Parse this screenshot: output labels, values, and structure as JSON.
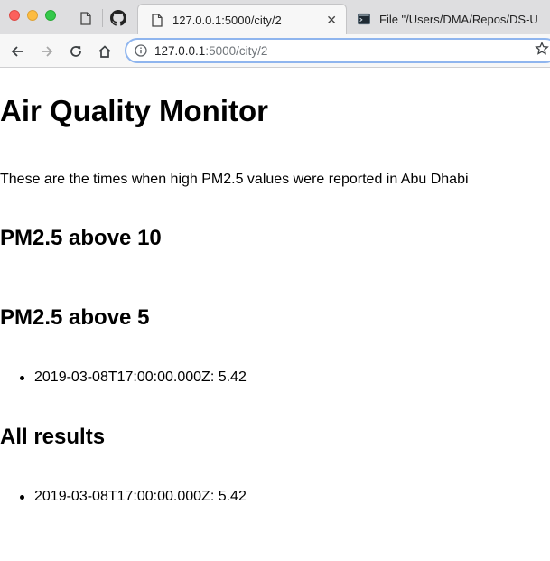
{
  "browser": {
    "tabs": [
      {
        "title": "127.0.0.1:5000/city/2",
        "active": true,
        "icon": "page-icon"
      },
      {
        "title": "File \"/Users/DMA/Repos/DS-U",
        "active": false,
        "icon": "terminal-icon"
      }
    ],
    "pinned_tabs": [
      "page-icon",
      "github-icon"
    ],
    "address": {
      "host": "127.0.0.1",
      "path": ":5000/city/2"
    },
    "accent_color": "#8fb5ee"
  },
  "page": {
    "title": "Air Quality Monitor",
    "intro": "These are the times when high PM2.5 values were reported in Abu Dhabi",
    "sections": [
      {
        "heading": "PM2.5 above 10",
        "items": []
      },
      {
        "heading": "PM2.5 above 5",
        "items": [
          "2019-03-08T17:00:00.000Z: 5.42"
        ]
      },
      {
        "heading": "All results",
        "items": [
          "2019-03-08T17:00:00.000Z: 5.42"
        ]
      }
    ]
  }
}
